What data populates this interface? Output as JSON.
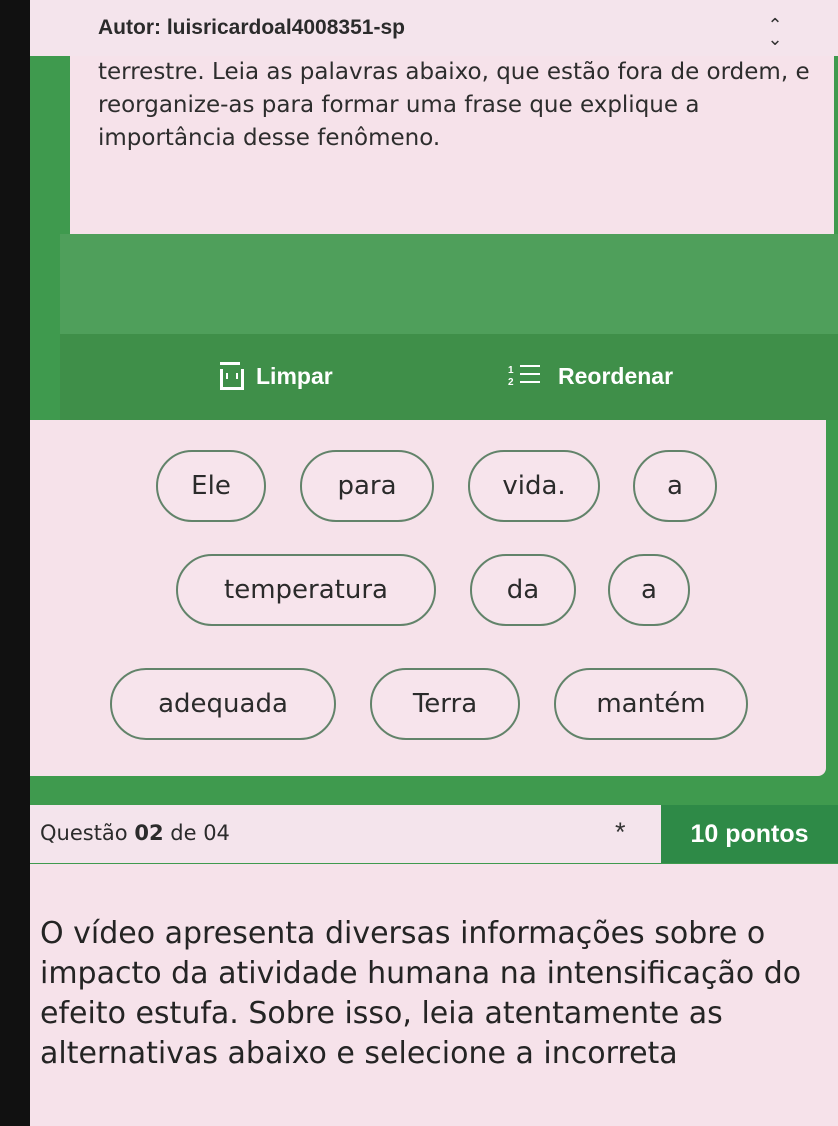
{
  "header": {
    "author": "Autor: luisricardoal4008351-sp"
  },
  "prompt": {
    "text": "terrestre. Leia as palavras abaixo, que estão fora de ordem, e reorganize-as para formar uma frase que explique a importância desse fenômeno."
  },
  "toolbar": {
    "clear_label": "Limpar",
    "reorder_label": "Reordenar",
    "reorder_icon_numbers": [
      "1",
      "2"
    ]
  },
  "word_chips": [
    {
      "text": "Ele"
    },
    {
      "text": "para"
    },
    {
      "text": "vida."
    },
    {
      "text": "a"
    },
    {
      "text": "temperatura"
    },
    {
      "text": "da"
    },
    {
      "text": "a"
    },
    {
      "text": "adequada"
    },
    {
      "text": "Terra"
    },
    {
      "text": "mantém"
    }
  ],
  "question": {
    "label_prefix": "Questão",
    "number": "02",
    "label_suffix": "de 04",
    "required_marker": "*",
    "points": "10 pontos",
    "text": "O vídeo apresenta diversas informações sobre o impacto da atividade humana na intensificação do efeito estufa. Sobre isso, leia atentamente as alternativas abaixo e selecione a incorreta"
  },
  "colors": {
    "green": "#3f9a4e",
    "pink": "#f6e2ea",
    "points_badge": "#2e8a47"
  },
  "icons": {
    "collapse": "chevron-up-down-icon",
    "clear": "trash-icon",
    "reorder": "numbered-list-icon"
  }
}
